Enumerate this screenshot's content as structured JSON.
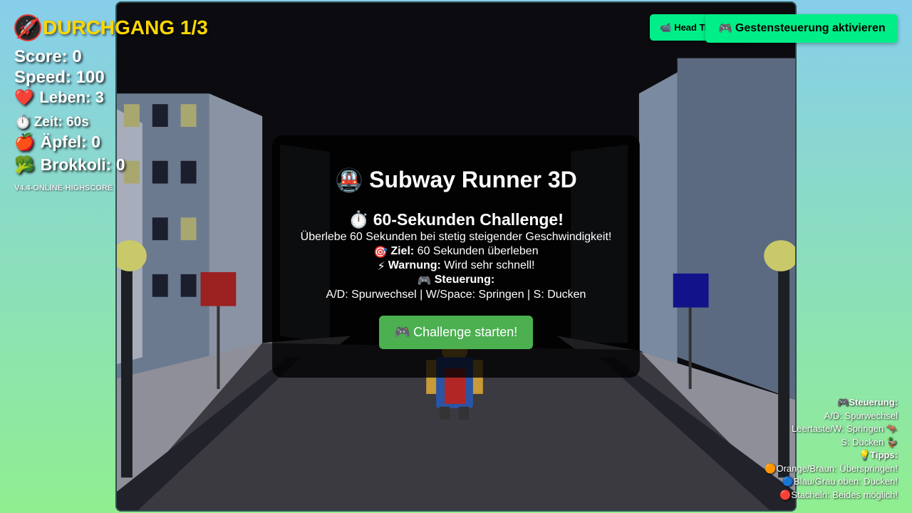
{
  "hud": {
    "round_icon": "🚀",
    "round": "DURCHGANG 1/3",
    "score": "Score: 0",
    "speed": "Speed: 100",
    "lives_icon": "❤️",
    "lives": "Leben: 3",
    "time_icon": "⏱️",
    "time": "Zeit: 60s",
    "apples_icon": "🍎",
    "apples": "Äpfel: 0",
    "broccoli_icon": "🥦",
    "broccoli": "Brokkoli: 0",
    "version": "V4.4-ONLINE-HIGHSCORE"
  },
  "buttons": {
    "head_tracking_icon": "📹",
    "head_tracking": "Head Tracking",
    "gesture_icon": "🎮",
    "gesture": "Gestensteuerung aktivieren"
  },
  "start_panel": {
    "title_icon": "🚇",
    "title": "Subway Runner 3D",
    "challenge_icon": "⏱️",
    "challenge": "60-Sekunden Challenge!",
    "survive": "Überlebe 60 Sekunden bei stetig steigender Geschwindigkeit!",
    "goal_icon": "🎯",
    "goal_label": "Ziel:",
    "goal": "60 Sekunden überleben",
    "warning_icon": "⚡",
    "warning_label": "Warnung:",
    "warning": "Wird sehr schnell!",
    "controls_icon": "🎮",
    "controls_label": "Steuerung:",
    "controls": "A/D: Spurwechsel | W/Space: Springen | S: Ducken",
    "start_icon": "🎮",
    "start": "Challenge starten!"
  },
  "help": {
    "controls_icon": "🎮",
    "controls_heading": "Steuerung:",
    "lane": "A/D: Spurwechsel",
    "jump": "Leertaste/W: Springen",
    "jump_icon": "🦘",
    "duck": "S: Ducken",
    "duck_icon": "🦆",
    "tips_icon": "💡",
    "tips_heading": "Tipps:",
    "tip1_icon": "🟠",
    "tip1": "Orange/Braun: Überspringen!",
    "tip2_icon": "🔵",
    "tip2": "Blau/Grau oben: Ducken!",
    "tip3_icon": "🔴",
    "tip3": "Stacheln: Beides möglich!"
  },
  "colors": {
    "round_text": "#ffd700",
    "action_button": "#00ee88",
    "start_button": "#4caf50",
    "sky_top": "#87ceeb",
    "sky_bottom": "#90ee90"
  }
}
